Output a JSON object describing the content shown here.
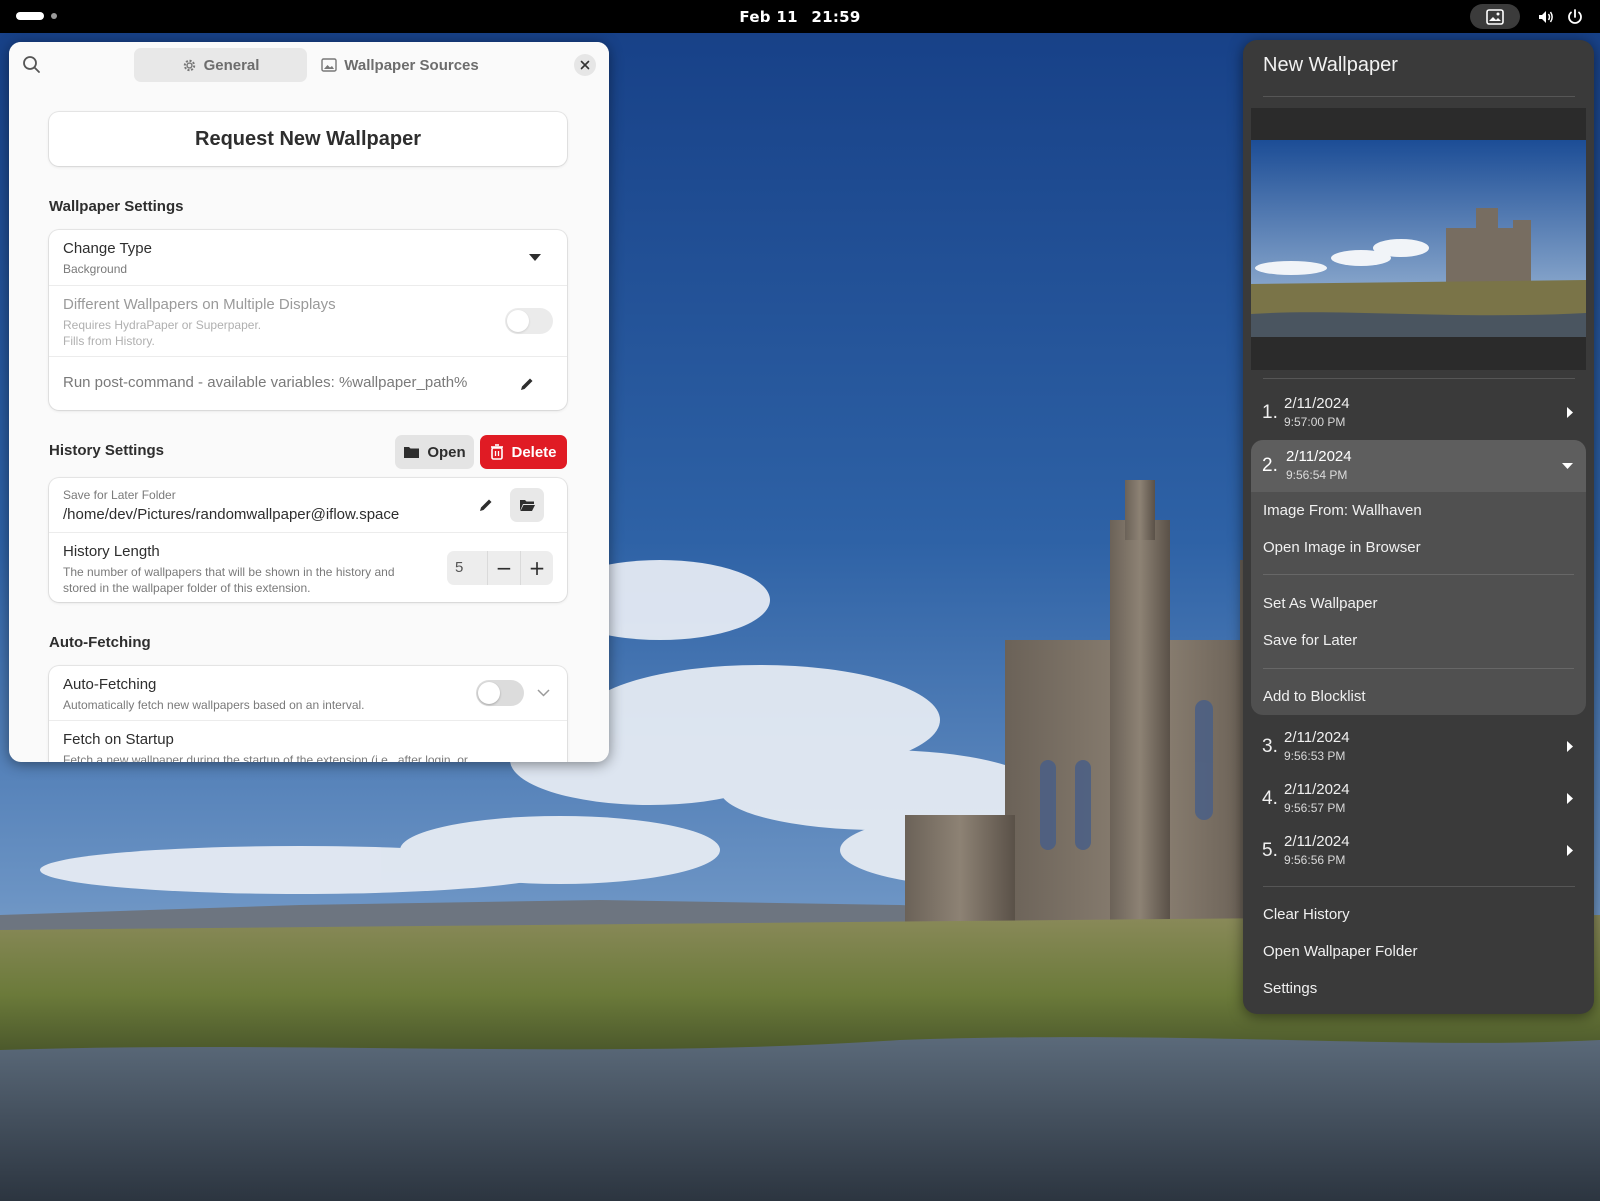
{
  "topbar": {
    "date": "Feb 11",
    "time": "21:59"
  },
  "prefs": {
    "tabs": [
      {
        "label": "General",
        "icon": "gear-icon",
        "active": true
      },
      {
        "label": "Wallpaper Sources",
        "icon": "image-icon",
        "active": false
      }
    ],
    "request_button": "Request New Wallpaper",
    "wallpaper_settings": {
      "title": "Wallpaper Settings",
      "change_type": {
        "title": "Change Type",
        "value": "Background"
      },
      "multi_display": {
        "title": "Different Wallpapers on Multiple Displays",
        "subtitle_line1": "Requires HydraPaper or Superpaper.",
        "subtitle_line2": "Fills from History.",
        "enabled": false
      },
      "post_command": {
        "placeholder": "Run post-command - available variables: %wallpaper_path%"
      }
    },
    "history_settings": {
      "title": "History Settings",
      "open_label": "Open",
      "delete_label": "Delete",
      "folder": {
        "title": "Save for Later Folder",
        "value": "/home/dev/Pictures/randomwallpaper@iflow.space"
      },
      "length": {
        "title": "History Length",
        "subtitle_line1": "The number of wallpapers that will be shown in the history and",
        "subtitle_line2": "stored in the wallpaper folder of this extension.",
        "value": "5",
        "minus": "−",
        "plus": "+"
      }
    },
    "auto_fetching": {
      "title": "Auto-Fetching",
      "row": {
        "title": "Auto-Fetching",
        "subtitle": "Automatically fetch new wallpapers based on an interval.",
        "enabled": false
      },
      "startup": {
        "title": "Fetch on Startup",
        "subtitle": "Fetch a new wallpaper during the startup of the extension (i.e., after login, or"
      }
    }
  },
  "menu": {
    "title": "New Wallpaper",
    "history": [
      {
        "num": "1.",
        "date": "2/11/2024",
        "time": "9:57:00 PM"
      },
      {
        "num": "2.",
        "date": "2/11/2024",
        "time": "9:56:54 PM",
        "expanded": true
      },
      {
        "num": "3.",
        "date": "2/11/2024",
        "time": "9:56:53 PM"
      },
      {
        "num": "4.",
        "date": "2/11/2024",
        "time": "9:56:57 PM"
      },
      {
        "num": "5.",
        "date": "2/11/2024",
        "time": "9:56:56 PM"
      }
    ],
    "submenu": {
      "image_from": "Image From: Wallhaven",
      "open_browser": "Open Image in Browser",
      "set_wallpaper": "Set As Wallpaper",
      "save_later": "Save for Later",
      "blocklist": "Add to Blocklist"
    },
    "actions": {
      "clear_history": "Clear History",
      "open_folder": "Open Wallpaper Folder",
      "settings": "Settings"
    }
  },
  "colors": {
    "accent_delete": "#e01b24",
    "menu_bg": "#3a3a3a",
    "window_bg": "#fafafa"
  }
}
